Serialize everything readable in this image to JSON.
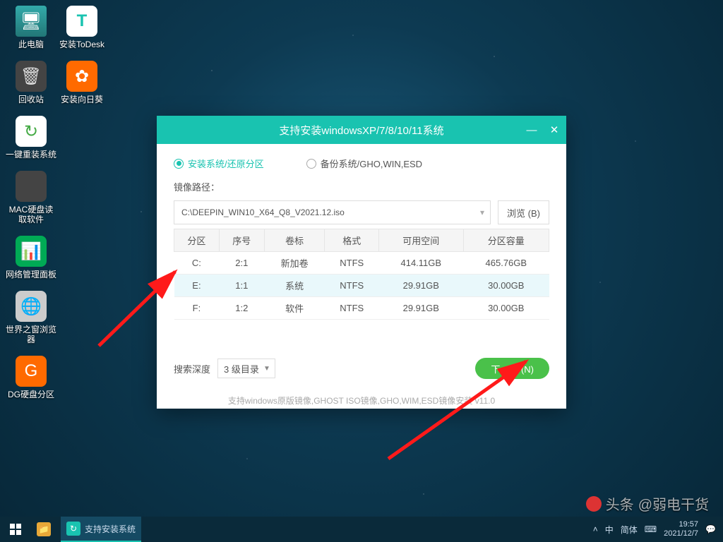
{
  "desktop": {
    "col1": [
      {
        "label": "此电脑",
        "icon": "monitor"
      },
      {
        "label": "回收站",
        "icon": "trash"
      },
      {
        "label": "一键重装系统",
        "icon": "reinstall"
      },
      {
        "label": "MAC硬盘读取软件",
        "icon": "apple"
      },
      {
        "label": "网络管理面板",
        "icon": "network"
      },
      {
        "label": "世界之窗浏览器",
        "icon": "globe"
      },
      {
        "label": "DG硬盘分区",
        "icon": "dg"
      }
    ],
    "col2": [
      {
        "label": "安装ToDesk",
        "icon": "todesk"
      },
      {
        "label": "安装向日葵",
        "icon": "sunflower"
      }
    ]
  },
  "window": {
    "title": "支持安装windowsXP/7/8/10/11系统",
    "radio_install": "安装系统/还原分区",
    "radio_backup": "备份系统/GHO,WIN,ESD",
    "path_label": "镜像路径：",
    "path_value": "C:\\DEEPIN_WIN10_X64_Q8_V2021.12.iso",
    "browse_btn": "浏览 (B)",
    "table": {
      "headers": [
        "分区",
        "序号",
        "卷标",
        "格式",
        "可用空间",
        "分区容量"
      ],
      "rows": [
        {
          "drive": "C:",
          "idx": "2:1",
          "label": "新加卷",
          "fs": "NTFS",
          "free": "414.11GB",
          "cap": "465.76GB"
        },
        {
          "drive": "E:",
          "idx": "1:1",
          "label": "系统",
          "fs": "NTFS",
          "free": "29.91GB",
          "cap": "30.00GB"
        },
        {
          "drive": "F:",
          "idx": "1:2",
          "label": "软件",
          "fs": "NTFS",
          "free": "29.91GB",
          "cap": "30.00GB"
        }
      ]
    },
    "depth_label": "搜索深度",
    "depth_value": "3 级目录",
    "next_btn": "下一步 (N)",
    "footnote": "支持windows原版镜像,GHOST ISO镜像,GHO,WIM,ESD镜像安装  v11.0"
  },
  "watermark": {
    "prefix": "头条",
    "author": "@弱电干货"
  },
  "taskbar": {
    "app_label": "支持安装系统",
    "tray": {
      "ime1": "中",
      "ime2": "简体",
      "time": "19:57",
      "date": "2021/12/7"
    }
  }
}
